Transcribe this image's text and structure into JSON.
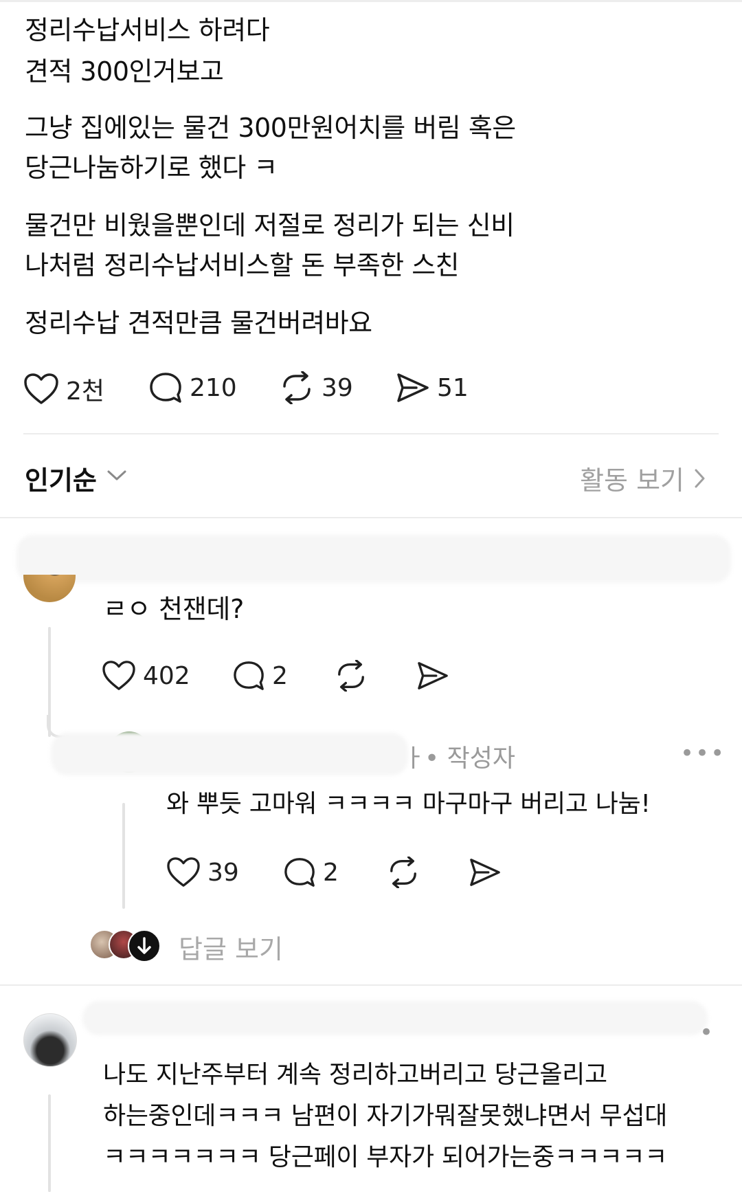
{
  "post": {
    "lines": [
      "정리수납서비스 하려다",
      "견적 300인거보고",
      "그냥 집에있는 물건 300만원어치를 버림 혹은",
      "당근나눔하기로 했다 ㅋ",
      "물건만 비웠을뿐인데 저절로 정리가 되는 신비",
      "나처럼 정리수납서비스할 돈 부족한 스친",
      "정리수납 견적만큼 물건버려바요"
    ],
    "actions": {
      "likes": "2천",
      "comments": "210",
      "reposts": "39",
      "shares": "51"
    }
  },
  "sort": {
    "label": "인기순",
    "activity_label": "활동 보기"
  },
  "comments": [
    {
      "text": "ㄹㅇ 천잰데?",
      "likes": "402",
      "replies": "2",
      "reply": {
        "author_suffix": "ㅏ",
        "author_badge": "• 작성자",
        "more": "•••",
        "text": "와 뿌듯 고마워 ㅋㅋㅋㅋ 마구마구 버리고 나눔!",
        "likes": "39",
        "replies": "2"
      },
      "view_replies": "답글 보기"
    },
    {
      "text_lines": [
        "나도 지난주부터 계속 정리하고버리고 당근올리고",
        "하는중인데ㅋㅋㅋ 남편이 자기가뭐잘못했냐면서 무섭대",
        "ㅋㅋㅋㅋㅋㅋㅋ 당근페이 부자가 되어가는중ㅋㅋㅋㅋㅋ"
      ],
      "more": "•"
    }
  ],
  "colors": {
    "text": "#101010",
    "muted": "#9a9a9a",
    "divider": "#ececec"
  }
}
